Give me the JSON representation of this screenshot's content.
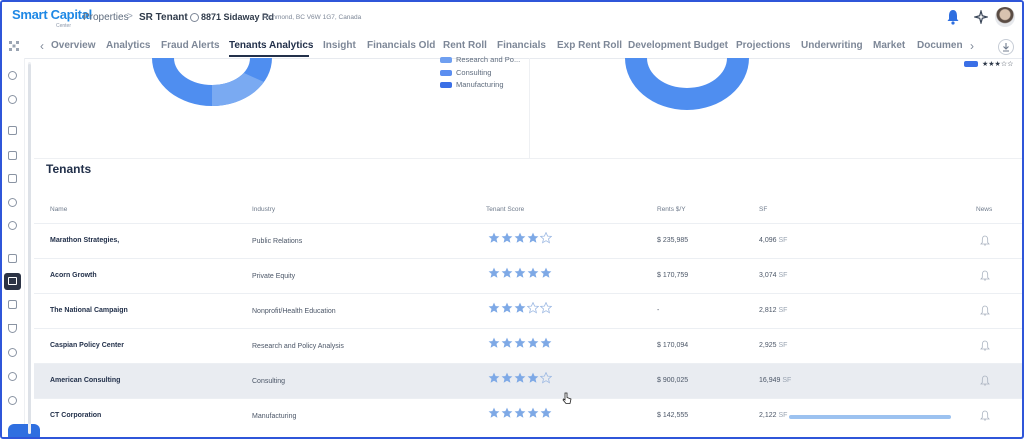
{
  "header": {
    "logo_text": "Smart Capital",
    "logo_subtext": "Center",
    "breadcrumb_root": "Properties",
    "breadcrumb_separator": ">",
    "breadcrumb_current": "SR Tenant",
    "address_main": "8871 Sidaway Rd",
    "address_sub": "Richmond, BC V6W 1G7, Canada",
    "icons": [
      "bell-icon",
      "sparkle-icon",
      "avatar"
    ]
  },
  "tabs": {
    "prev": "‹",
    "next": "›",
    "items": [
      "Overview",
      "Analytics",
      "Fraud Alerts",
      "Tenants Analytics",
      "Insight",
      "Financials Old",
      "Rent Roll",
      "Financials",
      "Exp Rent Roll",
      "Development Budget",
      "Projections",
      "Underwriting",
      "Market",
      "Documen"
    ],
    "active": "Tenants Analytics"
  },
  "chart_legend": [
    {
      "label": "Research and Po...",
      "color": "#6f9ff0"
    },
    {
      "label": "Consulting",
      "color": "#5b8ef0"
    },
    {
      "label": "Manufacturing",
      "color": "#3a6fe6"
    }
  ],
  "chart_legend_right": {
    "label": "★★★☆☆",
    "color": "#3a6fe6"
  },
  "colors": {
    "accent": "#2f6fe0",
    "donut": "#4f8ef0",
    "star_filled": "#7ea9e6",
    "border": "#2f56d9"
  },
  "tenants": {
    "title": "Tenants",
    "columns": {
      "name": "Name",
      "industry": "Industry",
      "score": "Tenant Score",
      "rent": "Rents $/Y",
      "sf": "SF",
      "news": "News"
    },
    "sf_unit": "SF",
    "rows": [
      {
        "name": "Marathon Strategies,",
        "industry": "Public Relations",
        "score": 4,
        "rent": "$ 235,985",
        "sf": "4,096"
      },
      {
        "name": "Acorn Growth",
        "industry": "Private Equity",
        "score": 5,
        "rent": "$ 170,759",
        "sf": "3,074"
      },
      {
        "name": "The National Campaign",
        "industry": "Nonprofit/Health Education",
        "score": 3,
        "rent": "-",
        "sf": "2,812"
      },
      {
        "name": "Caspian Policy Center",
        "industry": "Research and Policy Analysis",
        "score": 5,
        "rent": "$ 170,094",
        "sf": "2,925"
      },
      {
        "name": "American Consulting",
        "industry": "Consulting",
        "score": 4,
        "rent": "$ 900,025",
        "sf": "16,949"
      },
      {
        "name": "CT Corporation",
        "industry": "Manufacturing",
        "score": 5,
        "rent": "$ 142,555",
        "sf": "2,122"
      }
    ]
  }
}
